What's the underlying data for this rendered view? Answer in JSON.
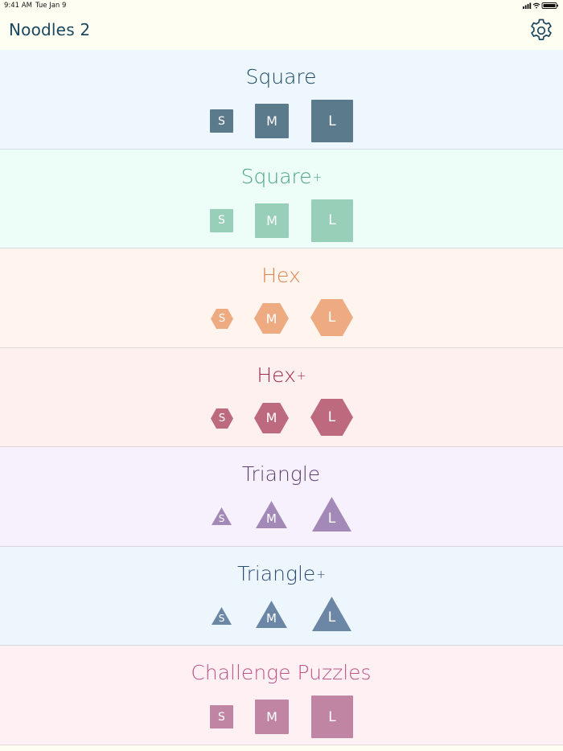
{
  "status_bar": {
    "time": "9:41 AM",
    "date": "Tue Jan 9"
  },
  "header": {
    "title": "Noodles 2"
  },
  "sections": [
    {
      "title": "Square",
      "plus": "",
      "shape": "square",
      "title_color": "#1c4a63",
      "bg": "#eef6fe",
      "shape_color": "#5b7a8c",
      "sizes": [
        "S",
        "M",
        "L"
      ]
    },
    {
      "title": "Square",
      "plus": "+",
      "shape": "square",
      "title_color": "#4aa285",
      "bg": "#edfdf7",
      "shape_color": "#98cfb9",
      "sizes": [
        "S",
        "M",
        "L"
      ]
    },
    {
      "title": "Hex",
      "plus": "",
      "shape": "hex",
      "title_color": "#e0844d",
      "bg": "#fff5ee",
      "shape_color": "#eeaa81",
      "sizes": [
        "S",
        "M",
        "L"
      ]
    },
    {
      "title": "Hex",
      "plus": "+",
      "shape": "hex",
      "title_color": "#9c2c4a",
      "bg": "#fff0f0",
      "shape_color": "#bd6a7f",
      "sizes": [
        "S",
        "M",
        "L"
      ]
    },
    {
      "title": "Triangle",
      "plus": "",
      "shape": "triangle",
      "title_color": "#5e3f73",
      "bg": "#f7f0fd",
      "shape_color": "#a389b7",
      "sizes": [
        "S",
        "M",
        "L"
      ]
    },
    {
      "title": "Triangle",
      "plus": "+",
      "shape": "triangle",
      "title_color": "#2c4a72",
      "bg": "#eef6fd",
      "shape_color": "#6c87a6",
      "sizes": [
        "S",
        "M",
        "L"
      ]
    },
    {
      "title": "Challenge Puzzles",
      "plus": "",
      "shape": "square",
      "title_color": "#bd5388",
      "bg": "#fff1f3",
      "shape_color": "#c085a3",
      "sizes": [
        "S",
        "M",
        "L"
      ]
    }
  ],
  "icons": {
    "settings": "gear-icon",
    "wifi": "wifi-icon",
    "battery": "battery-icon",
    "signal": "signal-icon"
  }
}
